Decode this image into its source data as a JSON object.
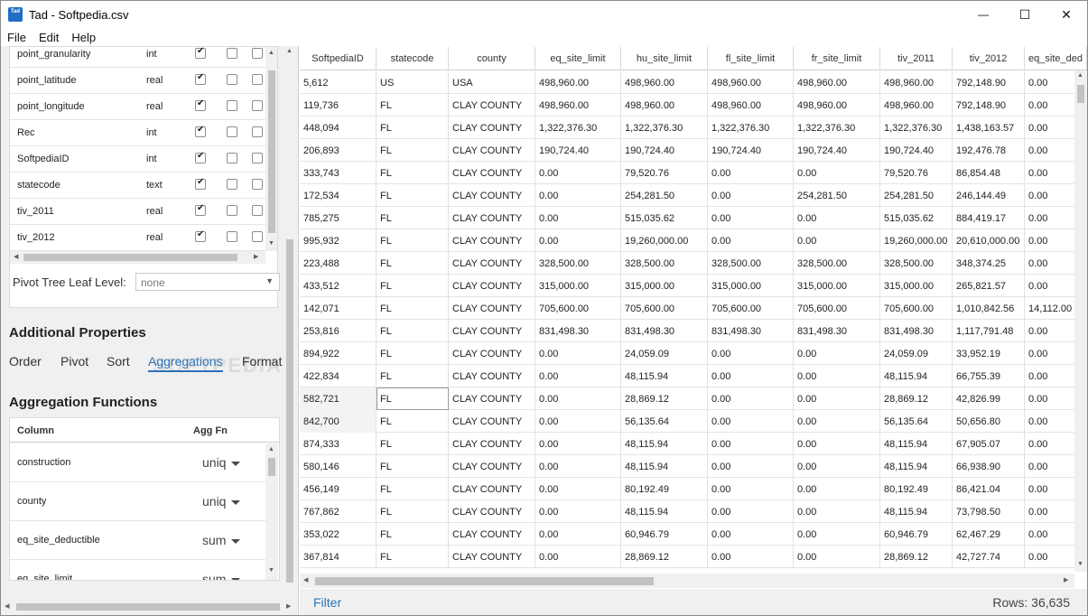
{
  "window": {
    "title": "Tad - Softpedia.csv",
    "icon_text": "Tad",
    "minimize": "—",
    "maximize": "☐",
    "close": "✕"
  },
  "menu": [
    "File",
    "Edit",
    "Help"
  ],
  "column_list": [
    {
      "name": "point_granularity",
      "type": "int"
    },
    {
      "name": "point_latitude",
      "type": "real"
    },
    {
      "name": "point_longitude",
      "type": "real"
    },
    {
      "name": "Rec",
      "type": "int"
    },
    {
      "name": "SoftpediaID",
      "type": "int"
    },
    {
      "name": "statecode",
      "type": "text"
    },
    {
      "name": "tiv_2011",
      "type": "real"
    },
    {
      "name": "tiv_2012",
      "type": "real"
    }
  ],
  "pivot": {
    "label": "Pivot Tree Leaf Level:",
    "value": "none"
  },
  "additional": {
    "title": "Additional Properties",
    "tabs": [
      "Order",
      "Pivot",
      "Sort",
      "Aggregations",
      "Format"
    ],
    "active_tab": "Aggregations"
  },
  "watermark": "SOFTPEDIA",
  "aggregation": {
    "title": "Aggregation Functions",
    "headers": {
      "column": "Column",
      "fn": "Agg Fn"
    },
    "rows": [
      {
        "column": "construction",
        "fn": "uniq"
      },
      {
        "column": "county",
        "fn": "uniq"
      },
      {
        "column": "eq_site_deductible",
        "fn": "sum"
      },
      {
        "column": "eq_site_limit",
        "fn": "sum"
      }
    ]
  },
  "grid": {
    "columns": [
      "SoftpediaID",
      "statecode",
      "county",
      "eq_site_limit",
      "hu_site_limit",
      "fl_site_limit",
      "fr_site_limit",
      "tiv_2011",
      "tiv_2012",
      "eq_site_ded"
    ],
    "rows": [
      [
        "5,612",
        "US",
        "USA",
        "498,960.00",
        "498,960.00",
        "498,960.00",
        "498,960.00",
        "498,960.00",
        "792,148.90",
        "0.00"
      ],
      [
        "119,736",
        "FL",
        "CLAY COUNTY",
        "498,960.00",
        "498,960.00",
        "498,960.00",
        "498,960.00",
        "498,960.00",
        "792,148.90",
        "0.00"
      ],
      [
        "448,094",
        "FL",
        "CLAY COUNTY",
        "1,322,376.30",
        "1,322,376.30",
        "1,322,376.30",
        "1,322,376.30",
        "1,322,376.30",
        "1,438,163.57",
        "0.00"
      ],
      [
        "206,893",
        "FL",
        "CLAY COUNTY",
        "190,724.40",
        "190,724.40",
        "190,724.40",
        "190,724.40",
        "190,724.40",
        "192,476.78",
        "0.00"
      ],
      [
        "333,743",
        "FL",
        "CLAY COUNTY",
        "0.00",
        "79,520.76",
        "0.00",
        "0.00",
        "79,520.76",
        "86,854.48",
        "0.00"
      ],
      [
        "172,534",
        "FL",
        "CLAY COUNTY",
        "0.00",
        "254,281.50",
        "0.00",
        "254,281.50",
        "254,281.50",
        "246,144.49",
        "0.00"
      ],
      [
        "785,275",
        "FL",
        "CLAY COUNTY",
        "0.00",
        "515,035.62",
        "0.00",
        "0.00",
        "515,035.62",
        "884,419.17",
        "0.00"
      ],
      [
        "995,932",
        "FL",
        "CLAY COUNTY",
        "0.00",
        "19,260,000.00",
        "0.00",
        "0.00",
        "19,260,000.00",
        "20,610,000.00",
        "0.00"
      ],
      [
        "223,488",
        "FL",
        "CLAY COUNTY",
        "328,500.00",
        "328,500.00",
        "328,500.00",
        "328,500.00",
        "328,500.00",
        "348,374.25",
        "0.00"
      ],
      [
        "433,512",
        "FL",
        "CLAY COUNTY",
        "315,000.00",
        "315,000.00",
        "315,000.00",
        "315,000.00",
        "315,000.00",
        "265,821.57",
        "0.00"
      ],
      [
        "142,071",
        "FL",
        "CLAY COUNTY",
        "705,600.00",
        "705,600.00",
        "705,600.00",
        "705,600.00",
        "705,600.00",
        "1,010,842.56",
        "14,112.00"
      ],
      [
        "253,816",
        "FL",
        "CLAY COUNTY",
        "831,498.30",
        "831,498.30",
        "831,498.30",
        "831,498.30",
        "831,498.30",
        "1,117,791.48",
        "0.00"
      ],
      [
        "894,922",
        "FL",
        "CLAY COUNTY",
        "0.00",
        "24,059.09",
        "0.00",
        "0.00",
        "24,059.09",
        "33,952.19",
        "0.00"
      ],
      [
        "422,834",
        "FL",
        "CLAY COUNTY",
        "0.00",
        "48,115.94",
        "0.00",
        "0.00",
        "48,115.94",
        "66,755.39",
        "0.00"
      ],
      [
        "582,721",
        "FL",
        "CLAY COUNTY",
        "0.00",
        "28,869.12",
        "0.00",
        "0.00",
        "28,869.12",
        "42,826.99",
        "0.00"
      ],
      [
        "842,700",
        "FL",
        "CLAY COUNTY",
        "0.00",
        "56,135.64",
        "0.00",
        "0.00",
        "56,135.64",
        "50,656.80",
        "0.00"
      ],
      [
        "874,333",
        "FL",
        "CLAY COUNTY",
        "0.00",
        "48,115.94",
        "0.00",
        "0.00",
        "48,115.94",
        "67,905.07",
        "0.00"
      ],
      [
        "580,146",
        "FL",
        "CLAY COUNTY",
        "0.00",
        "48,115.94",
        "0.00",
        "0.00",
        "48,115.94",
        "66,938.90",
        "0.00"
      ],
      [
        "456,149",
        "FL",
        "CLAY COUNTY",
        "0.00",
        "80,192.49",
        "0.00",
        "0.00",
        "80,192.49",
        "86,421.04",
        "0.00"
      ],
      [
        "767,862",
        "FL",
        "CLAY COUNTY",
        "0.00",
        "48,115.94",
        "0.00",
        "0.00",
        "48,115.94",
        "73,798.50",
        "0.00"
      ],
      [
        "353,022",
        "FL",
        "CLAY COUNTY",
        "0.00",
        "60,946.79",
        "0.00",
        "0.00",
        "60,946.79",
        "62,467.29",
        "0.00"
      ],
      [
        "367,814",
        "FL",
        "CLAY COUNTY",
        "0.00",
        "28,869.12",
        "0.00",
        "0.00",
        "28,869.12",
        "42,727.74",
        "0.00"
      ]
    ]
  },
  "footer": {
    "filter": "Filter",
    "rows": "Rows: 36,635"
  }
}
